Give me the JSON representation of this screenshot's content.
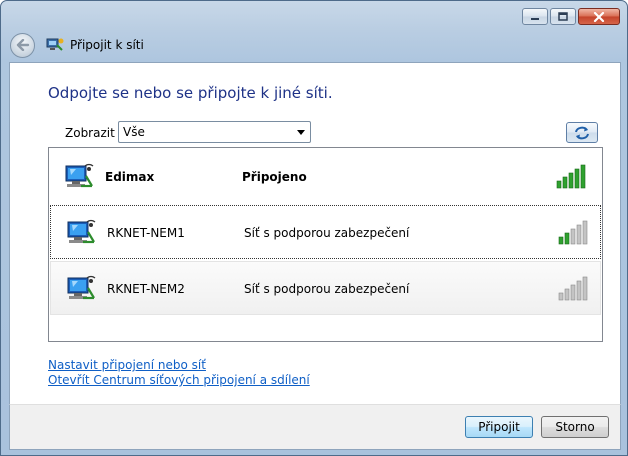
{
  "window": {
    "title": "Připojit k síti",
    "icons": [
      "minimize-icon",
      "maximize-icon",
      "close-icon"
    ]
  },
  "content": {
    "heading": "Odpojte se nebo se připojte k jiné síti.",
    "show_label": "Zobrazit",
    "show_value": "Vše"
  },
  "networks": [
    {
      "name": "Edimax",
      "status": "Připojeno",
      "bold": true,
      "signal_bars": 5,
      "signal_color": "#2fa12f"
    },
    {
      "name": "RKNET-NEM1",
      "status": "Síť s podporou zabezpečení",
      "bold": false,
      "signal_bars": 2,
      "signal_color": "#2fa12f"
    },
    {
      "name": "RKNET-NEM2",
      "status": "Síť s podporou zabezpečení",
      "bold": false,
      "signal_bars": 0,
      "signal_color": "#2fa12f"
    }
  ],
  "links": {
    "setup": "Nastavit připojení nebo síť",
    "center": "Otevřít Centrum síťových připojení a sdílení"
  },
  "buttons": {
    "connect": "Připojit",
    "cancel": "Storno"
  },
  "colors": {
    "heading": "#1e3287",
    "link": "#0f5fc6",
    "signal_active": "#2fa12f",
    "signal_inactive": "#b8b8b8"
  }
}
